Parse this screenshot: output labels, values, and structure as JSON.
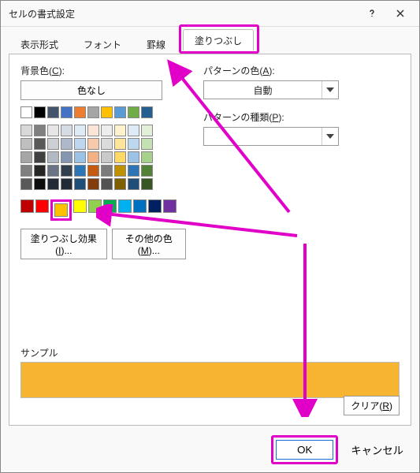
{
  "title": "セルの書式設定",
  "tabs": {
    "display": "表示形式",
    "font": "フォント",
    "border": "罫線",
    "fill": "塗りつぶし"
  },
  "left": {
    "bgcolor_label_pre": "背景色(",
    "bgcolor_access": "C",
    "bgcolor_label_post": "):",
    "nocolor": "色なし",
    "fill_effects_pre": "塗りつぶし効果(",
    "fill_effects_access": "I",
    "fill_effects_post": ")...",
    "more_colors_pre": "その他の色(",
    "more_colors_access": "M",
    "more_colors_post": ")..."
  },
  "right": {
    "pattern_color_pre": "パターンの色(",
    "pattern_color_access": "A",
    "pattern_color_post": "):",
    "pattern_color_value": "自動",
    "pattern_type_pre": "パターンの種類(",
    "pattern_type_access": "P",
    "pattern_type_post": "):"
  },
  "sample_label": "サンプル",
  "clear_pre": "クリア(",
  "clear_access": "R",
  "clear_post": ")",
  "ok": "OK",
  "cancel": "キャンセル",
  "palette": {
    "theme_row": [
      "#ffffff",
      "#000000",
      "#44546a",
      "#4472c4",
      "#ed7d31",
      "#a5a5a5",
      "#ffc000",
      "#5b9bd5",
      "#70ad47",
      "#255e91"
    ],
    "shades": [
      [
        "#d9d9d9",
        "#808080",
        "#e6e6e6",
        "#d6dce4",
        "#deebf6",
        "#fbe5d6",
        "#ededed",
        "#fff2cc",
        "#deebf7",
        "#e2f0d9"
      ],
      [
        "#bfbfbf",
        "#595959",
        "#ccd0d5",
        "#adb9ca",
        "#bdd7ee",
        "#f7caac",
        "#dbdbdb",
        "#ffe599",
        "#bdd7ee",
        "#c5e0b3"
      ],
      [
        "#a6a6a6",
        "#404040",
        "#b2b9c2",
        "#8496b0",
        "#9cc3e5",
        "#f4b183",
        "#c9c9c9",
        "#ffd965",
        "#9cc3e5",
        "#a8d08d"
      ],
      [
        "#808080",
        "#262626",
        "#6b7484",
        "#323f4f",
        "#2e75b5",
        "#c55a11",
        "#7b7b7b",
        "#bf9000",
        "#2e75b5",
        "#538135"
      ],
      [
        "#595959",
        "#0d0d0d",
        "#222a35",
        "#222a35",
        "#1f4e79",
        "#833c0b",
        "#525252",
        "#7f6000",
        "#1f4e79",
        "#375623"
      ]
    ],
    "standard": [
      "#c00000",
      "#ff0000",
      "#ffc000",
      "#ffff00",
      "#92d050",
      "#00b050",
      "#00b0f0",
      "#0070c0",
      "#002060",
      "#7030a0"
    ],
    "selected_index": 2,
    "selected_color": "#ffc000"
  }
}
